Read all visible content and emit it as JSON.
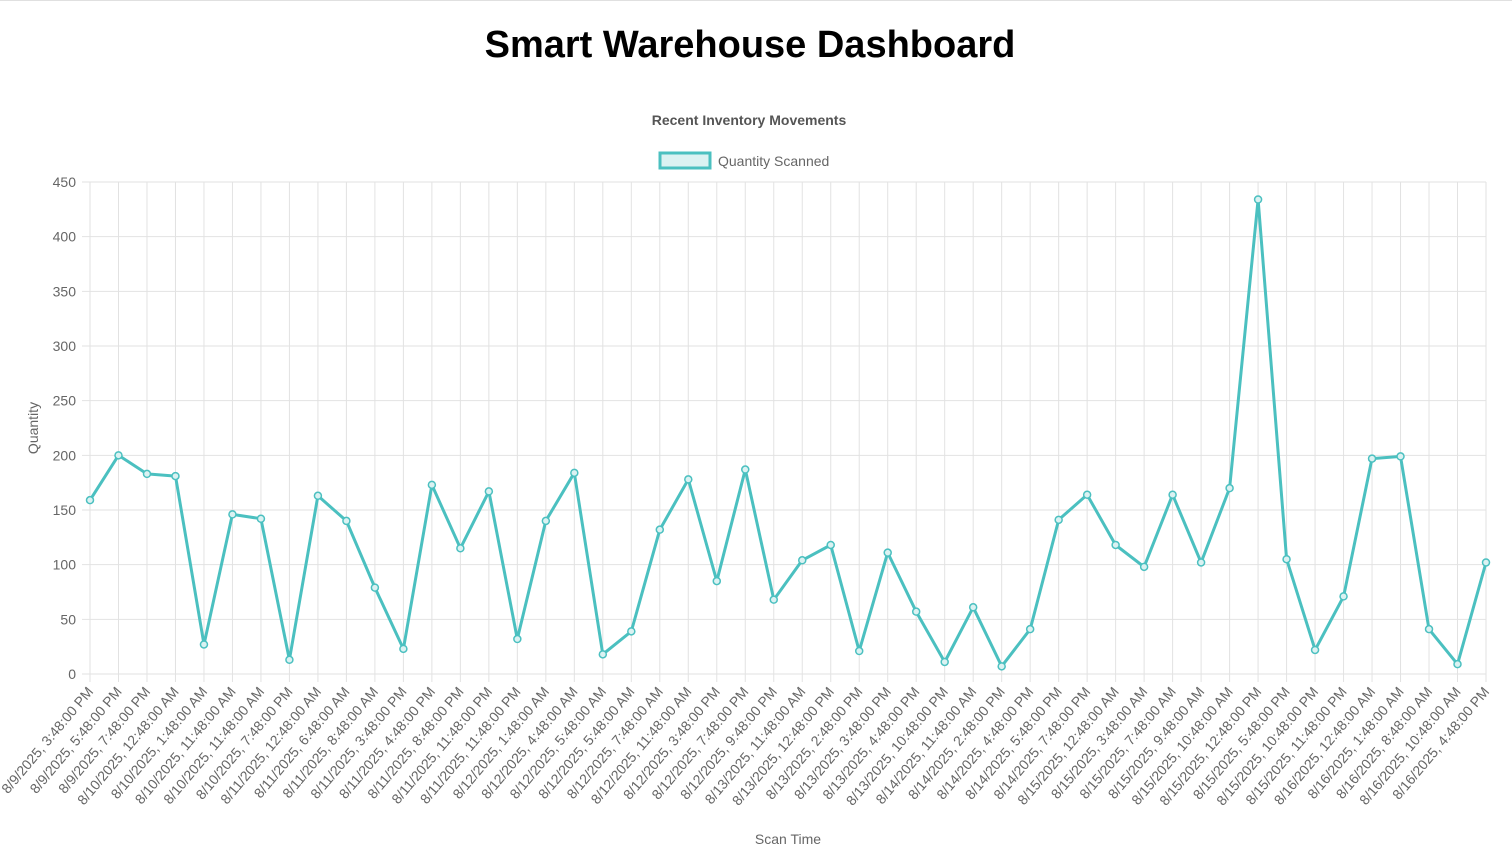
{
  "page": {
    "title": "Smart Warehouse Dashboard"
  },
  "colors": {
    "series": "#4bc0c0",
    "series_fill": "#dbf2f2",
    "grid": "#e2e2e2",
    "text": "#666666"
  },
  "chart_data": {
    "type": "line",
    "title": "Recent Inventory Movements",
    "xlabel": "Scan Time",
    "ylabel": "Quantity",
    "ylim": [
      0,
      450
    ],
    "yticks": [
      0,
      50,
      100,
      150,
      200,
      250,
      300,
      350,
      400,
      450
    ],
    "grid": true,
    "legend_position": "top-center",
    "categories": [
      "8/9/2025, 3:48:00 PM",
      "8/9/2025, 5:48:00 PM",
      "8/9/2025, 7:48:00 PM",
      "8/10/2025, 12:48:00 AM",
      "8/10/2025, 1:48:00 AM",
      "8/10/2025, 11:48:00 AM",
      "8/10/2025, 11:48:00 AM",
      "8/10/2025, 7:48:00 PM",
      "8/11/2025, 12:48:00 AM",
      "8/11/2025, 6:48:00 AM",
      "8/11/2025, 8:48:00 AM",
      "8/11/2025, 3:48:00 PM",
      "8/11/2025, 4:48:00 PM",
      "8/11/2025, 8:48:00 PM",
      "8/11/2025, 11:48:00 PM",
      "8/11/2025, 11:48:00 PM",
      "8/12/2025, 1:48:00 AM",
      "8/12/2025, 4:48:00 AM",
      "8/12/2025, 5:48:00 AM",
      "8/12/2025, 5:48:00 AM",
      "8/12/2025, 7:48:00 AM",
      "8/12/2025, 11:48:00 AM",
      "8/12/2025, 3:48:00 PM",
      "8/12/2025, 7:48:00 PM",
      "8/12/2025, 9:48:00 PM",
      "8/13/2025, 11:48:00 AM",
      "8/13/2025, 12:48:00 PM",
      "8/13/2025, 2:48:00 PM",
      "8/13/2025, 3:48:00 PM",
      "8/13/2025, 4:48:00 PM",
      "8/13/2025, 10:48:00 PM",
      "8/14/2025, 11:48:00 AM",
      "8/14/2025, 2:48:00 PM",
      "8/14/2025, 4:48:00 PM",
      "8/14/2025, 5:48:00 PM",
      "8/14/2025, 7:48:00 PM",
      "8/15/2025, 12:48:00 AM",
      "8/15/2025, 3:48:00 AM",
      "8/15/2025, 7:48:00 AM",
      "8/15/2025, 9:48:00 AM",
      "8/15/2025, 10:48:00 AM",
      "8/15/2025, 12:48:00 PM",
      "8/15/2025, 5:48:00 PM",
      "8/15/2025, 10:48:00 PM",
      "8/15/2025, 11:48:00 PM",
      "8/16/2025, 12:48:00 AM",
      "8/16/2025, 1:48:00 AM",
      "8/16/2025, 8:48:00 AM",
      "8/16/2025, 10:48:00 AM",
      "8/16/2025, 4:48:00 PM"
    ],
    "series": [
      {
        "name": "Quantity Scanned",
        "values": [
          159,
          200,
          183,
          181,
          27,
          146,
          142,
          13,
          163,
          140,
          79,
          23,
          173,
          115,
          167,
          32,
          140,
          184,
          18,
          39,
          132,
          178,
          85,
          187,
          68,
          104,
          118,
          21,
          111,
          57,
          11,
          61,
          7,
          41,
          141,
          164,
          118,
          98,
          164,
          102,
          170,
          434,
          105,
          22,
          71,
          197,
          199,
          41,
          9,
          102
        ]
      }
    ]
  }
}
